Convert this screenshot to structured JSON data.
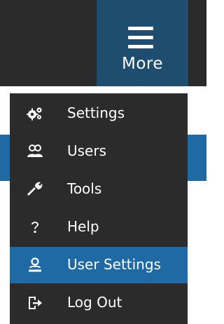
{
  "toolbar": {
    "more_label": "More"
  },
  "menu": {
    "items": [
      {
        "label": "Settings",
        "icon": "gears-icon"
      },
      {
        "label": "Users",
        "icon": "users-icon"
      },
      {
        "label": "Tools",
        "icon": "wrench-icon"
      },
      {
        "label": "Help",
        "icon": "question-icon"
      },
      {
        "label": "User Settings",
        "icon": "user-icon",
        "active": true
      },
      {
        "label": "Log Out",
        "icon": "logout-icon"
      }
    ]
  },
  "colors": {
    "bar_bg": "#2a2a2a",
    "more_tile_bg": "#1f4d70",
    "menu_bg": "#2b2b2b",
    "active_bg": "#1f6aa5",
    "text": "#ffffff"
  }
}
